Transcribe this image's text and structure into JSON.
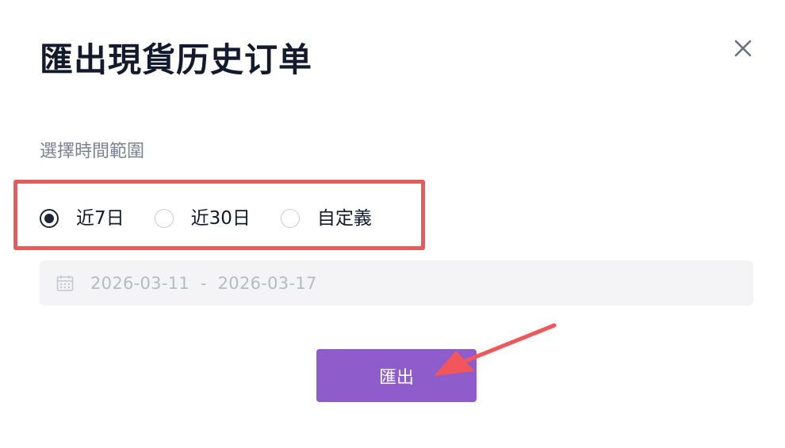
{
  "dialog": {
    "title": "匯出現貨历史订单",
    "close_icon": "close-icon"
  },
  "range": {
    "label": "選擇時間範圍",
    "options": [
      {
        "label": "近7日",
        "checked": true
      },
      {
        "label": "近30日",
        "checked": false
      },
      {
        "label": "自定義",
        "checked": false
      }
    ]
  },
  "date_range": {
    "icon": "calendar-icon",
    "start": "2026-03-11",
    "separator": "-",
    "end": "2026-03-17"
  },
  "export_button": {
    "label": "匯出"
  },
  "colors": {
    "accent": "#8f5ccc",
    "annotation": "#f0565a",
    "title": "#141a2e"
  }
}
